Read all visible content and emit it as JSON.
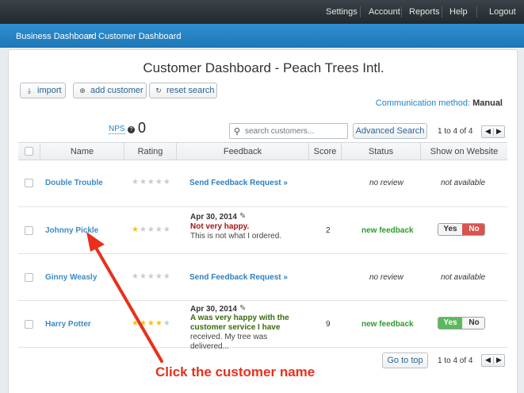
{
  "topnav": {
    "items": [
      "Settings",
      "Account",
      "Reports",
      "Help",
      "Logout"
    ]
  },
  "breadcrumb": {
    "parent": "Business Dashboard",
    "separator": "»",
    "current": "Customer Dashboard"
  },
  "page": {
    "title": "Customer Dashboard - Peach Trees Intl."
  },
  "toolbar": {
    "import_label": "import",
    "add_customer_label": "add customer",
    "reset_search_label": "reset search",
    "communication_label": "Communication method:",
    "communication_value": "Manual"
  },
  "nps": {
    "label": "NPS",
    "help_icon": "question-icon",
    "value": "0"
  },
  "search": {
    "placeholder": "search customers...",
    "advanced_label": "Advanced Search"
  },
  "pagination": {
    "text": "1 to 4 of 4",
    "prev_icon": "prev-icon",
    "next_icon": "next-icon"
  },
  "table": {
    "headers": [
      "Name",
      "Rating",
      "Feedback",
      "Score",
      "Status",
      "Show on Website"
    ],
    "rows": [
      {
        "name": "Double Trouble",
        "rating": 0,
        "feedback_link": "Send Feedback Request »",
        "score": "",
        "status": "no review",
        "website": "not available"
      },
      {
        "name": "Johnny Pickle",
        "rating": 1,
        "feedback_date": "Apr 30, 2014",
        "feedback_headline": "Not very happy.",
        "feedback_body": "This is not what I ordered.",
        "score": "2",
        "status": "new feedback",
        "toggle_yes": "Yes",
        "toggle_no": "No",
        "toggle_selected": "No"
      },
      {
        "name": "Ginny Weasly",
        "rating": 0,
        "feedback_link": "Send Feedback Request »",
        "score": "",
        "status": "no review",
        "website": "not available"
      },
      {
        "name": "Harry Potter",
        "rating": 4,
        "feedback_date": "Apr 30, 2014",
        "feedback_headline": "A was very happy with the customer service I have",
        "feedback_body": "received. My tree was delivered...",
        "score": "9",
        "status": "new feedback",
        "toggle_yes": "Yes",
        "toggle_no": "No",
        "toggle_selected": "Yes"
      }
    ]
  },
  "footer": {
    "go_to_top_label": "Go to top",
    "pagination_text": "1 to 4 of 4"
  },
  "annotation": {
    "text": "Click the customer name",
    "color": "#e8301c"
  },
  "colors": {
    "link": "#3a8bc6",
    "new_feedback": "#2e9a2e",
    "negative": "#a31616",
    "toggle_yes_on": "#5cb85c",
    "toggle_no_on": "#d9534f",
    "star_on": "#f0c419"
  }
}
